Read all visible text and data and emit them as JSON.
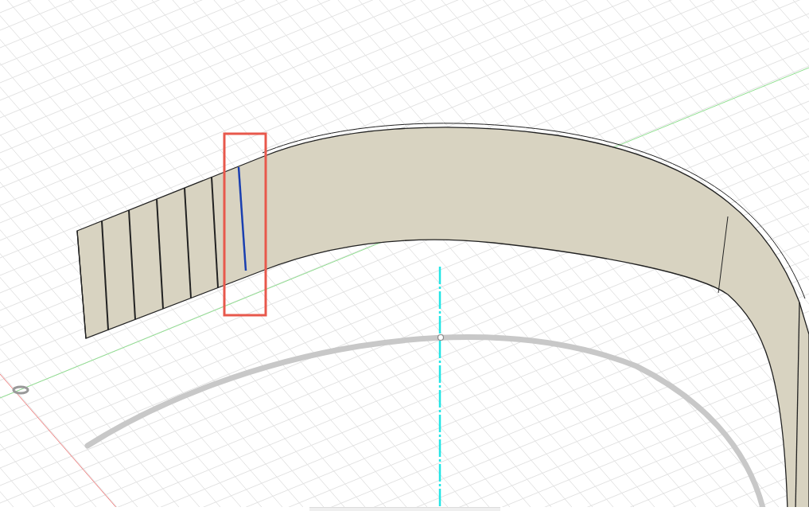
{
  "viewport": {
    "selection_frame_visible": true,
    "selected_edge_highlighted": true,
    "bottom_toolbar_visible": true
  }
}
